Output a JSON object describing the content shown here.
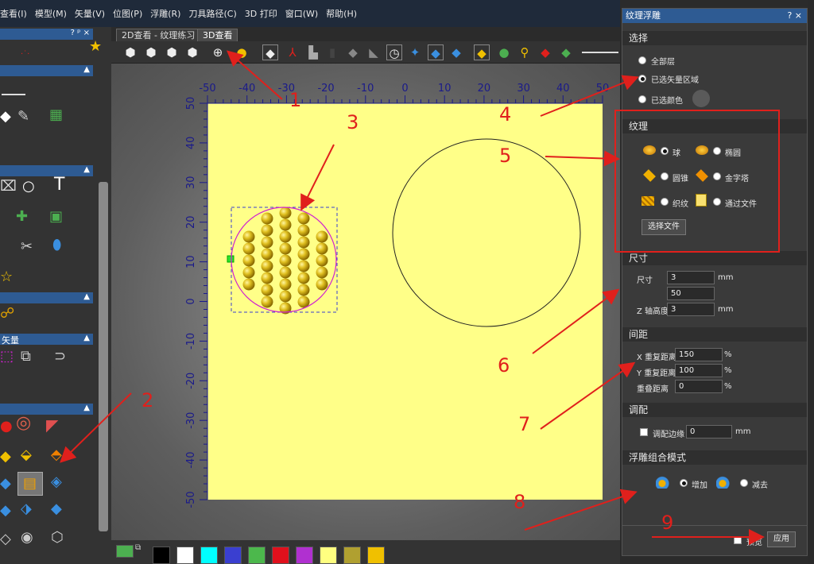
{
  "menu": [
    "查看(I)",
    "模型(M)",
    "矢量(V)",
    "位图(P)",
    "浮雕(R)",
    "刀具路径(C)",
    "3D 打印",
    "窗口(W)",
    "帮助(H)"
  ],
  "left_panel": {
    "title_controls": "? ᵖ ×",
    "section_vector_label": "矢量"
  },
  "tabs": [
    "2D查看 - 纹理练习",
    "3D查看"
  ],
  "ruler": {
    "x_ticks": [
      "-50",
      "-40",
      "-30",
      "-20",
      "-10",
      "0",
      "10",
      "20",
      "30",
      "40",
      "50"
    ],
    "y_ticks": [
      "50",
      "40",
      "30",
      "20",
      "10",
      "0",
      "-10",
      "-20",
      "-30",
      "-40",
      "-50"
    ]
  },
  "dialog": {
    "title": "纹理浮雕",
    "title_controls": "? ×",
    "select": {
      "header": "选择",
      "options": [
        "全部层",
        "已选矢量区域",
        "已选颜色"
      ],
      "selected_index": 1
    },
    "texture": {
      "header": "纹理",
      "options": [
        "球",
        "椭圆",
        "圆锥",
        "金字塔",
        "织纹",
        "通过文件"
      ],
      "selected_index": 0,
      "choose_file_button": "选择文件"
    },
    "size": {
      "header": "尺寸",
      "size_label": "尺寸",
      "size_value": "3",
      "size_unit": "mm",
      "second_value": "50",
      "z_label": "Z 轴高度",
      "z_value": "3",
      "z_unit": "mm"
    },
    "spacing": {
      "header": "间距",
      "x_label": "X 重复距离",
      "x_value": "150",
      "y_label": "Y 重复距离",
      "y_value": "100",
      "overlap_label": "重叠距离",
      "overlap_value": "0",
      "unit": "%"
    },
    "fit": {
      "header": "调配",
      "edge_label": "调配边缘",
      "edge_value": "0",
      "edge_unit": "mm"
    },
    "combine": {
      "header": "浮雕组合模式",
      "options": [
        "增加",
        "减去"
      ],
      "selected_index": 0
    },
    "footer": {
      "preview_label": "预览",
      "apply_button": "应用"
    }
  },
  "annotations": [
    "1",
    "2",
    "3",
    "4",
    "5",
    "6",
    "7",
    "8",
    "9"
  ],
  "colors": {
    "accent": "#2e5b93",
    "canvas": "#ffff99",
    "annotation": "#e0201c",
    "palette": [
      "#4caf50",
      "#000000",
      "#ffffff",
      "#00ffff",
      "#3a3fd0",
      "#4cb84c",
      "#e0101c",
      "#b030d0",
      "#ffff80",
      "#b0a030",
      "#f0c000"
    ]
  }
}
